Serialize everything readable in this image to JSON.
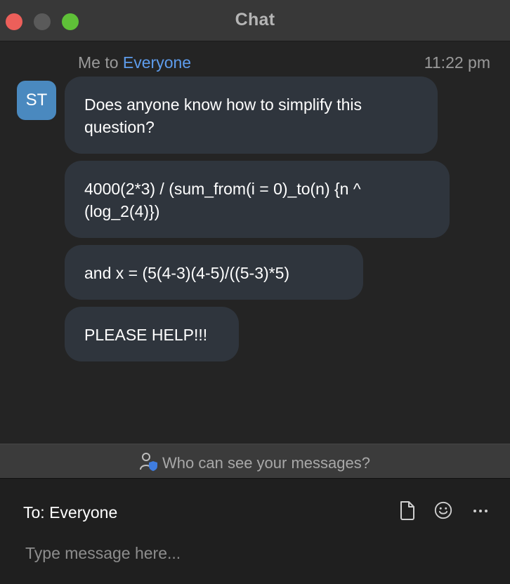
{
  "window": {
    "title": "Chat",
    "traffic_lights": {
      "close_color": "#ec5f5a",
      "minimize_color": "#5a5a5a",
      "zoom_color": "#5fc038"
    }
  },
  "message_group": {
    "sender": "Me",
    "to_word": "to",
    "recipient": "Everyone",
    "time": "11:22 pm",
    "avatar_initials": "ST",
    "avatar_color": "#4a89bf",
    "messages": [
      "Does anyone know how to simplify this question?",
      "4000(2*3) / (sum_from(i = 0)_to(n) {n ^ (log_2(4)})",
      "and x = (5(4-3)(4-5)/((5-3)*5)",
      "PLEASE HELP!!!"
    ]
  },
  "visibility": {
    "label": "Who can see your messages?",
    "icon": "person-shield-icon"
  },
  "composer": {
    "to_label": "To: Everyone",
    "placeholder": "Type message here...",
    "value": "",
    "icons": [
      "file-icon",
      "emoji-icon",
      "more-icon"
    ]
  },
  "colors": {
    "accent": "#5e9cec",
    "bubble": "#2f353d",
    "background": "#242424"
  }
}
